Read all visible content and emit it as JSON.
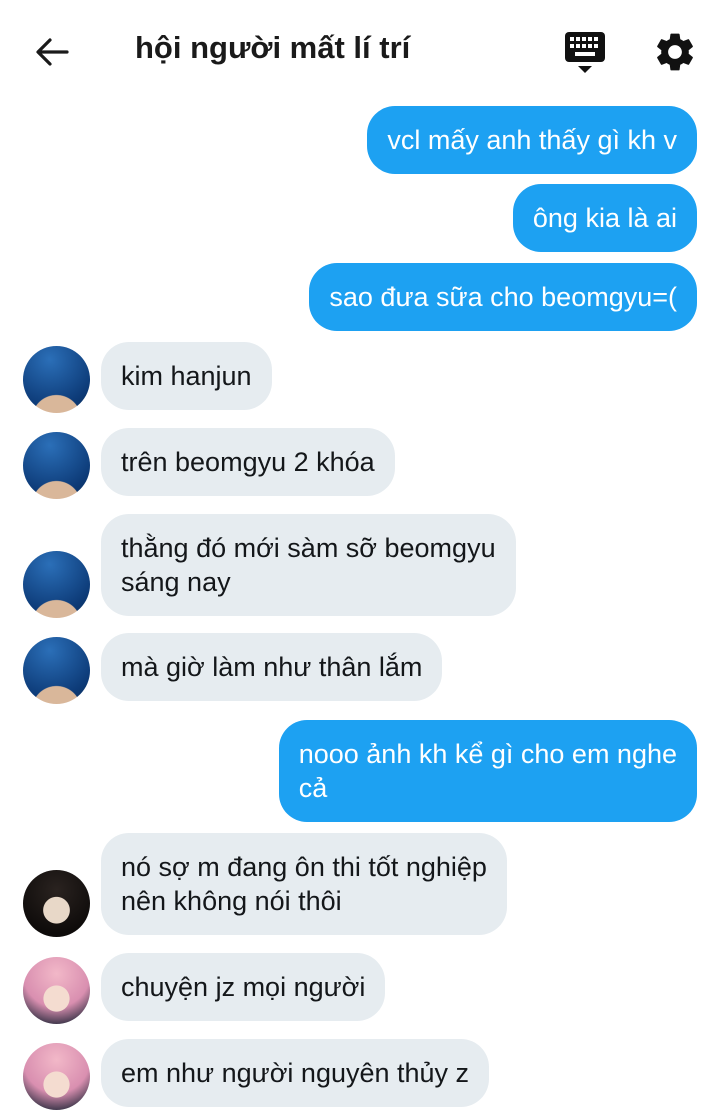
{
  "header": {
    "title": "hội người mất lí trí"
  },
  "messages": [
    {
      "text": "vcl mấy anh thấy gì kh v"
    },
    {
      "text": "ông kia là ai"
    },
    {
      "text": "sao đưa sữa cho beomgyu=("
    },
    {
      "text": "kim hanjun"
    },
    {
      "text": "trên beomgyu 2 khóa"
    },
    {
      "line1": "thằng đó mới sàm sỡ beomgyu",
      "line2": "sáng nay"
    },
    {
      "text": "mà giờ làm như thân lắm"
    },
    {
      "line1": "nooo ảnh kh kể gì cho em nghe",
      "line2": "cả"
    },
    {
      "line1": "nó sợ m đang ôn thi tốt nghiệp",
      "line2": "nên không nói thôi"
    },
    {
      "text": "chuyện jz mọi người"
    },
    {
      "text": "em như người nguyên thủy z"
    }
  ],
  "colors": {
    "outgoing_bubble": "#1da1f2",
    "incoming_bubble": "#e6ecf0"
  }
}
